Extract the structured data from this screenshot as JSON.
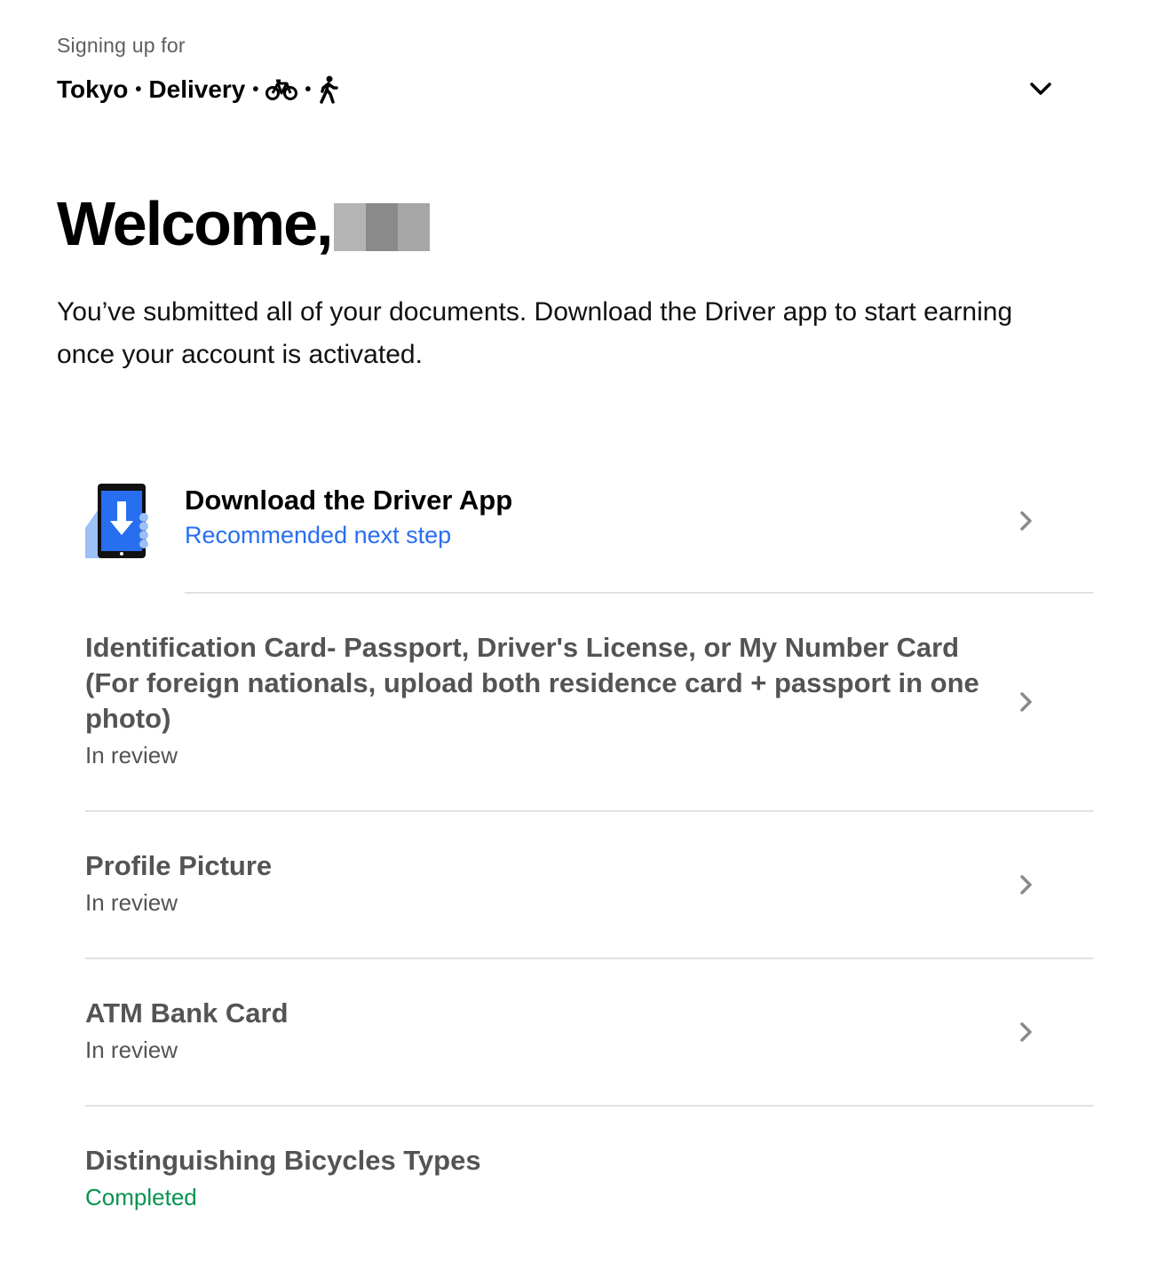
{
  "header": {
    "signing_label": "Signing up for",
    "city": "Tokyo",
    "service": "Delivery",
    "separator": "•",
    "vehicle_icons": [
      "bicycle-icon",
      "walking-person-icon"
    ],
    "dropdown_icon": "chevron-down-icon"
  },
  "welcome": {
    "greeting": "Welcome,",
    "name_redacted": true
  },
  "intro_text": "You’ve submitted all of your documents. Download the Driver app to start earning once your account is activated.",
  "steps": {
    "app": {
      "title": "Download the Driver App",
      "status": "Recommended next step",
      "icon": "phone-download-icon"
    },
    "id_card": {
      "title": "Identification Card- Passport, Driver's License, or My Number Card (For foreign nationals, upload both residence card + passport in one photo)",
      "status": "In review"
    },
    "profile_picture": {
      "title": "Profile Picture",
      "status": "In review"
    },
    "atm_card": {
      "title": "ATM Bank Card",
      "status": "In review"
    },
    "bicycle_types": {
      "title": "Distinguishing Bicycles Types",
      "status": "Completed"
    }
  },
  "colors": {
    "link_blue": "#276ef1",
    "completed_green": "#05944f",
    "muted_text": "#545454",
    "divider": "#e2e2e2"
  }
}
